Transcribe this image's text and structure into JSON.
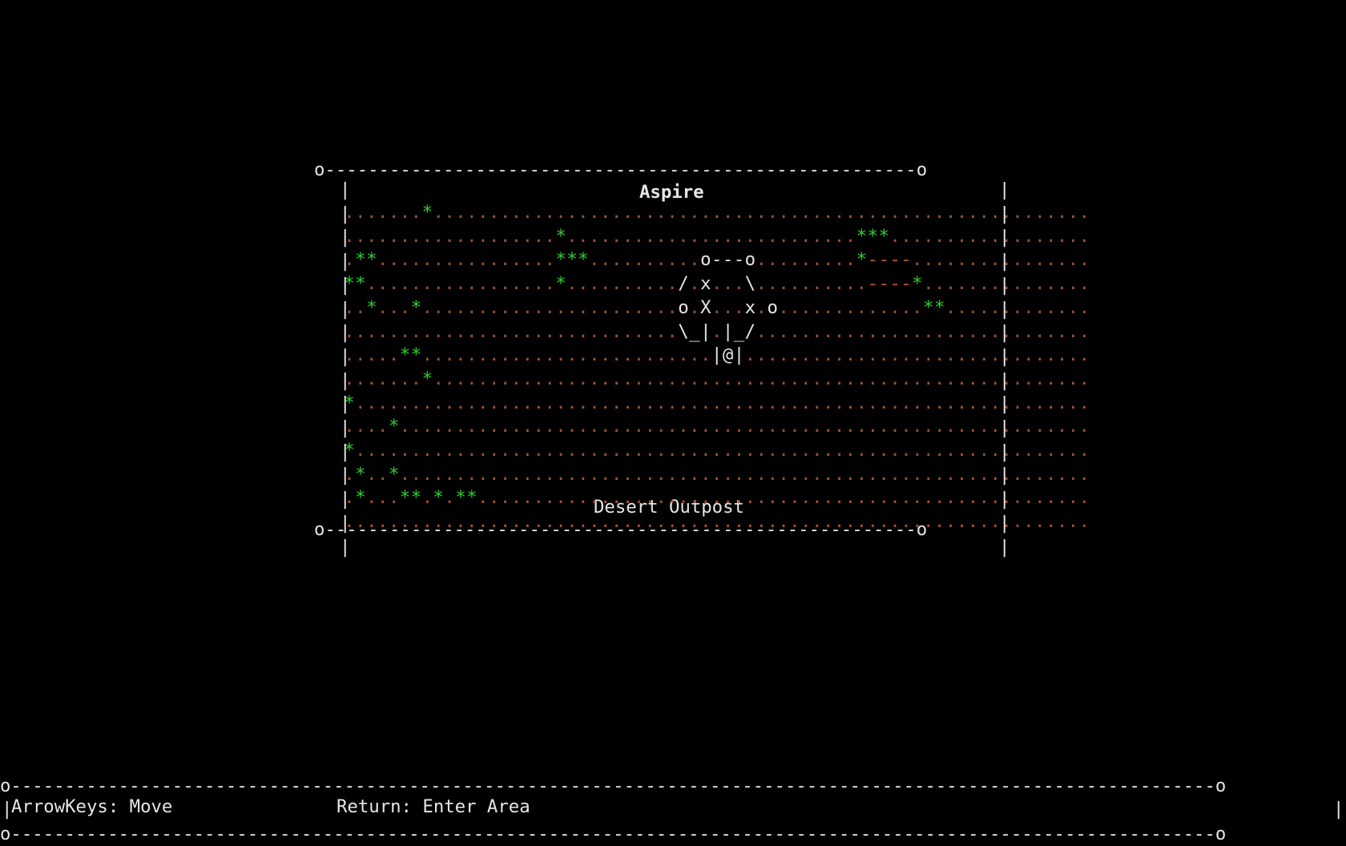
{
  "map_window": {
    "title": "Aspire",
    "area_name": "Desert Outpost",
    "rows": [
      ".......*...........................................................",
      "...................*..........................***..................",
      ".**................***..........o---o.........*----................",
      "**.................*........../.x...\\..........----*...............",
      "..*...*.......................o.X...x.o.............**.............",
      "..............................\\_|.|_/..............................",
      ".....**..........................|@|...............................",
      ".......*...........................................................",
      "*..................................................................",
      "....*..............................................................",
      "*..................................................................",
      ".*..*..............................................................",
      ".*...**.*.**.......................................................",
      "..................................................................."
    ]
  },
  "status_bar": {
    "move_hint": "ArrowKeys: Move",
    "enter_hint": "Return: Enter Area"
  },
  "colors": {
    "background": "#000000",
    "text": "#e6e6e6",
    "ground": "#a0522d",
    "tree": "#2fce2f",
    "road": "#b8552a"
  }
}
